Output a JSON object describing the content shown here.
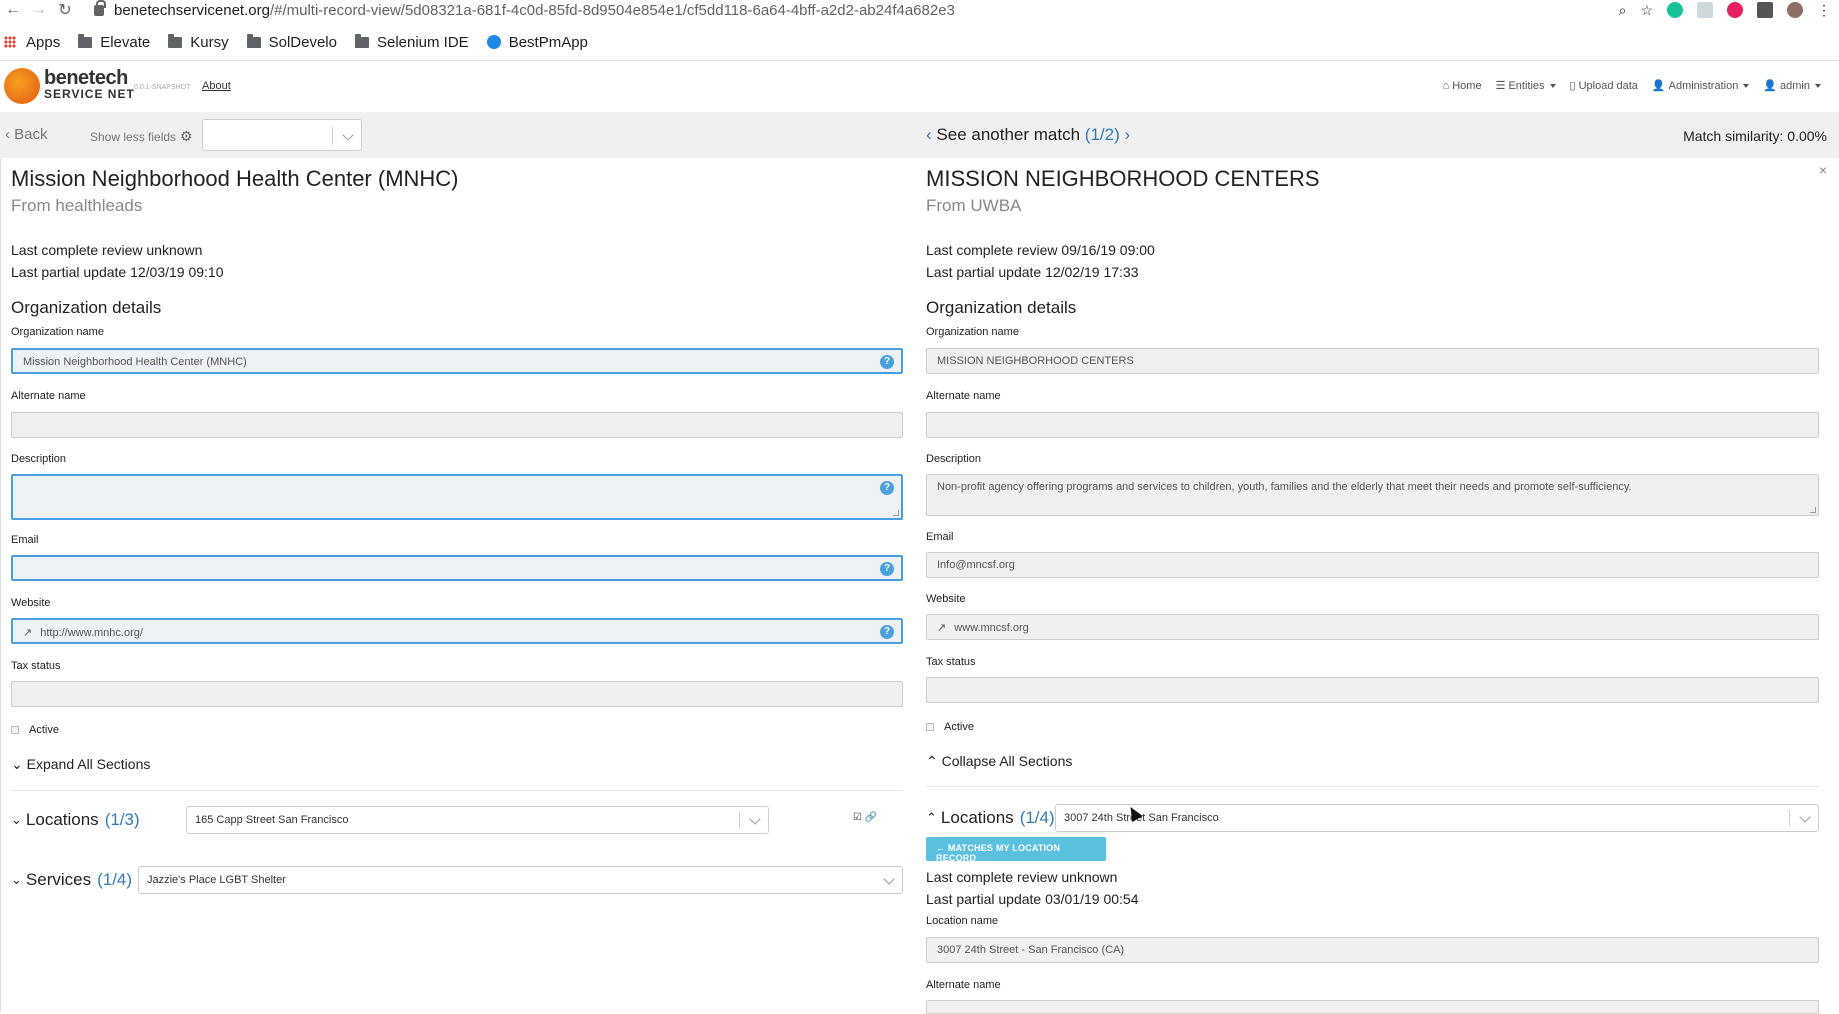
{
  "browser": {
    "url_host": "benetechservicenet.org",
    "url_path": "/#/multi-record-view/5d08321a-681f-4c0d-85fd-8d9504e854e1/cf5dd118-6a64-4bff-a2d2-ab24f4a682e3",
    "bookmarks": [
      "Apps",
      "Elevate",
      "Kursy",
      "SolDevelo",
      "Selenium IDE",
      "BestPmApp"
    ]
  },
  "header": {
    "logo_line1": "benetech",
    "logo_line2": "SERVICE NET",
    "version": "0.0.1-SNAPSHOT",
    "about": "About",
    "nav": [
      "Home",
      "Entities",
      "Upload data",
      "Administration",
      "admin"
    ]
  },
  "toolbar": {
    "back": "Back",
    "show_less": "Show less fields",
    "another_match_label": "See another match",
    "another_match_count": "(1/2)",
    "similarity": "Match similarity: 0.00%"
  },
  "left": {
    "title": "Mission Neighborhood Health Center (MNHC)",
    "source": "From healthleads",
    "last_review": "Last complete review unknown",
    "last_update": "Last partial update 12/03/19 09:10",
    "section": "Organization details",
    "labels": {
      "org_name": "Organization name",
      "alt_name": "Alternate name",
      "description": "Description",
      "email": "Email",
      "website": "Website",
      "tax_status": "Tax status",
      "active": "Active"
    },
    "values": {
      "org_name": "Mission Neighborhood Health Center (MNHC)",
      "alt_name": "",
      "description": "",
      "email": "",
      "website": "http://www.mnhc.org/",
      "tax_status": ""
    },
    "toggle_all": "Expand All Sections",
    "locations_label": "Locations",
    "locations_count": "(1/3)",
    "locations_value": "165 Capp Street San Francisco",
    "services_label": "Services",
    "services_count": "(1/4)",
    "services_value": "Jazzie's Place LGBT Shelter"
  },
  "right": {
    "title": "MISSION NEIGHBORHOOD CENTERS",
    "source": "From UWBA",
    "last_review": "Last complete review 09/16/19 09:00",
    "last_update": "Last partial update 12/02/19 17:33",
    "section": "Organization details",
    "labels": {
      "org_name": "Organization name",
      "alt_name": "Alternate name",
      "description": "Description",
      "email": "Email",
      "website": "Website",
      "tax_status": "Tax status",
      "active": "Active"
    },
    "values": {
      "org_name": "MISSION NEIGHBORHOOD CENTERS",
      "alt_name": "",
      "description": "Non-profit agency offering programs and services to children, youth, families and the elderly that meet their needs and promote self-sufficiency.",
      "email": "Info@mncsf.org",
      "website": "www.mncsf.org",
      "tax_status": ""
    },
    "toggle_all": "Collapse All Sections",
    "locations_label": "Locations",
    "locations_count": "(1/4)",
    "locations_value": "3007 24th Street San Francisco",
    "match_button": "← MATCHES MY LOCATION RECORD",
    "loc_review": "Last complete review unknown",
    "loc_update": "Last partial update 03/01/19 00:54",
    "loc_name_label": "Location name",
    "loc_name_value": "3007 24th Street - San Francisco (CA)",
    "loc_alt_label": "Alternate name"
  },
  "icons": {
    "close": "×",
    "help": "?",
    "external": "↗"
  }
}
